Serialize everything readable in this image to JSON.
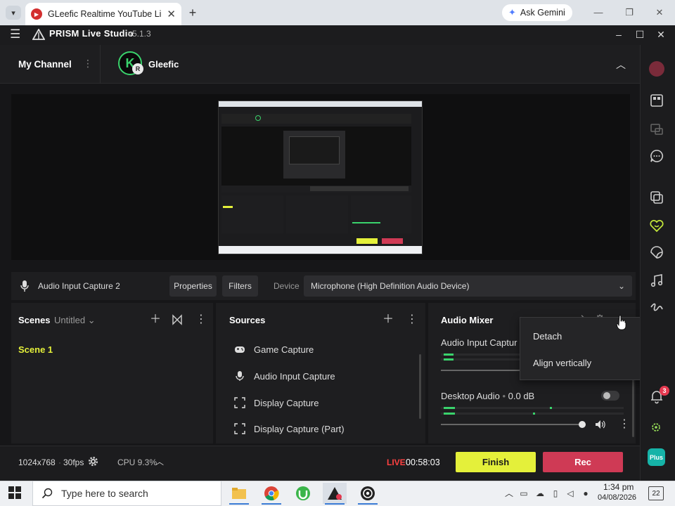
{
  "browser": {
    "tab_title": "GLeefic Realtime YouTube Live",
    "gemini_label": "Ask Gemini",
    "new_tab": "+",
    "close": "✕"
  },
  "app": {
    "name": "PRISM Live Studio",
    "version": "v5.1.3"
  },
  "channel": {
    "label": "My Channel",
    "name": "Gleefic",
    "avatar_letter": "K",
    "badge_letter": "R"
  },
  "source_bar": {
    "source_name": "Audio Input Capture 2",
    "properties_label": "Properties",
    "filters_label": "Filters",
    "device_label": "Device",
    "device_value": "Microphone (High Definition Audio Device)"
  },
  "scenes": {
    "title": "Scenes",
    "collection": "Untitled",
    "items": [
      "Scene 1"
    ]
  },
  "sources": {
    "title": "Sources",
    "items": [
      {
        "label": "Game Capture",
        "icon": "gamepad-icon"
      },
      {
        "label": "Audio Input Capture",
        "icon": "microphone-icon"
      },
      {
        "label": "Display Capture",
        "icon": "display-capture-icon"
      },
      {
        "label": "Display Capture (Part)",
        "icon": "display-capture-icon"
      }
    ]
  },
  "mixer": {
    "title": "Audio Mixer",
    "channels": [
      {
        "name": "Audio Input Captur"
      },
      {
        "name": "Desktop Audio",
        "level": "0.0 dB",
        "volume_fraction": 1.0
      }
    ]
  },
  "context_menu": {
    "items": [
      "Detach",
      "Align vertically"
    ]
  },
  "status": {
    "resolution": "1024x768",
    "fps": "30fps",
    "cpu": "CPU 9.3%",
    "live_label": "LIVE",
    "live_time": "00:58:03",
    "finish_label": "Finish",
    "rec_label": "Rec"
  },
  "sidebar": {
    "notification_count": "3",
    "plus_label": "Plus"
  },
  "taskbar": {
    "search_placeholder": "Type here to search",
    "time": "1:34 pm",
    "date": "04/08/2026",
    "notif_count": "22"
  },
  "colors": {
    "accent_yellow": "#e4f03a",
    "rec_red": "#cf3a55",
    "live_red": "#ff4141",
    "channel_green": "#3ad36c"
  }
}
